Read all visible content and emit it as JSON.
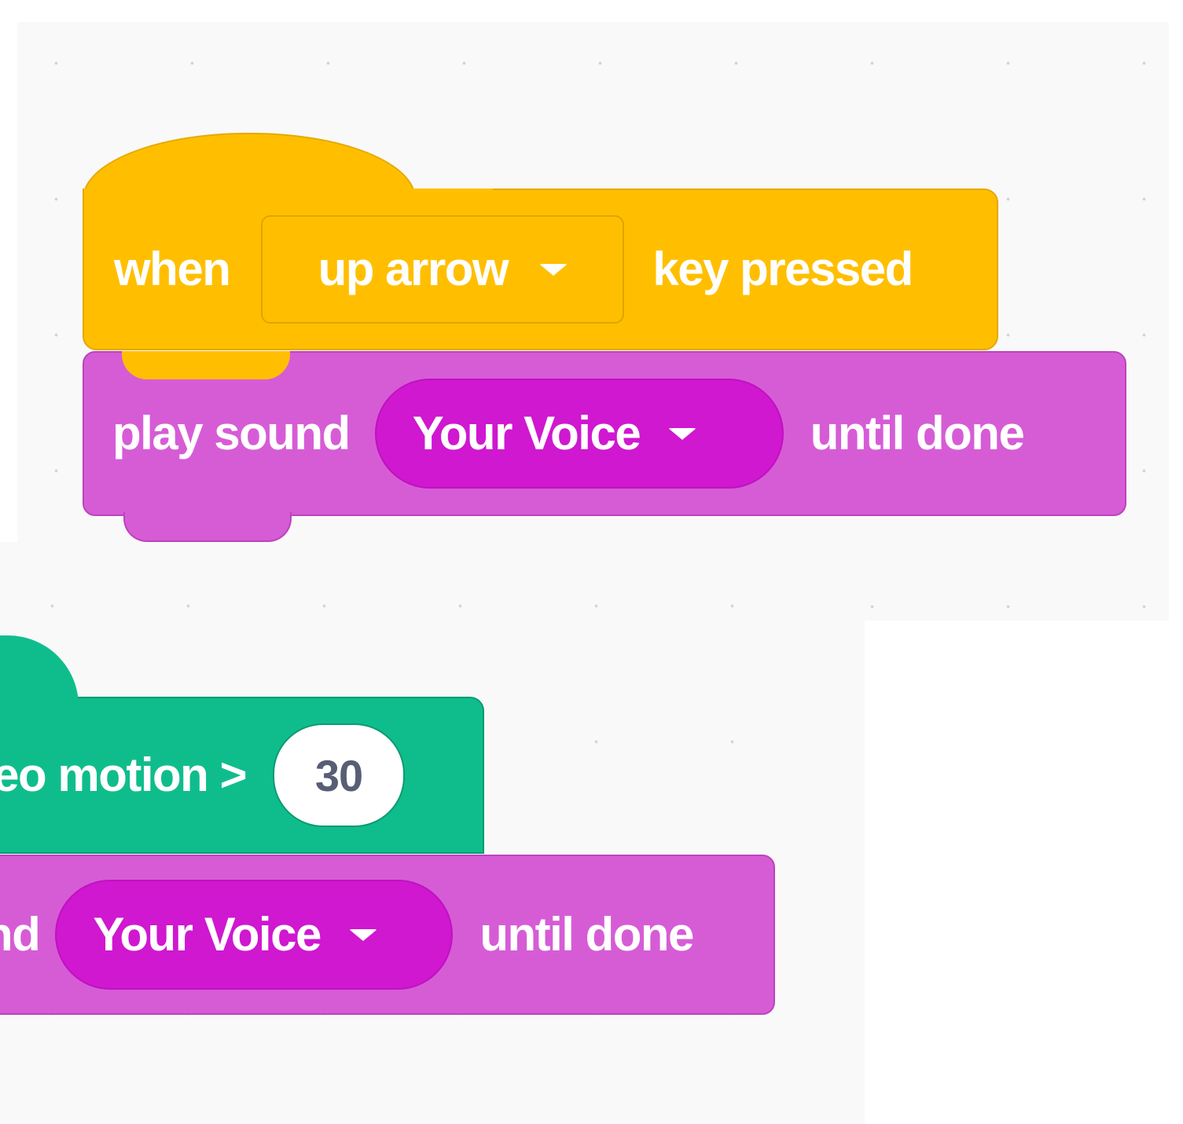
{
  "blocks": {
    "when_key_pressed": {
      "when_label": "when",
      "key_value": "up arrow",
      "key_pressed_label": "key pressed",
      "color": "#ffbf00"
    },
    "play_sound_1": {
      "label": "play sound",
      "sound_value": "Your Voice",
      "until_label": "until done",
      "color": "#d65cd6"
    },
    "video_motion": {
      "label": "leo motion >",
      "value": "30",
      "color": "#0fbd8c"
    },
    "play_sound_2": {
      "label": "nd",
      "sound_value": "Your Voice",
      "until_label": "until done",
      "color": "#d65cd6"
    }
  },
  "icons": {
    "dropdown": "chevron-down-icon"
  }
}
